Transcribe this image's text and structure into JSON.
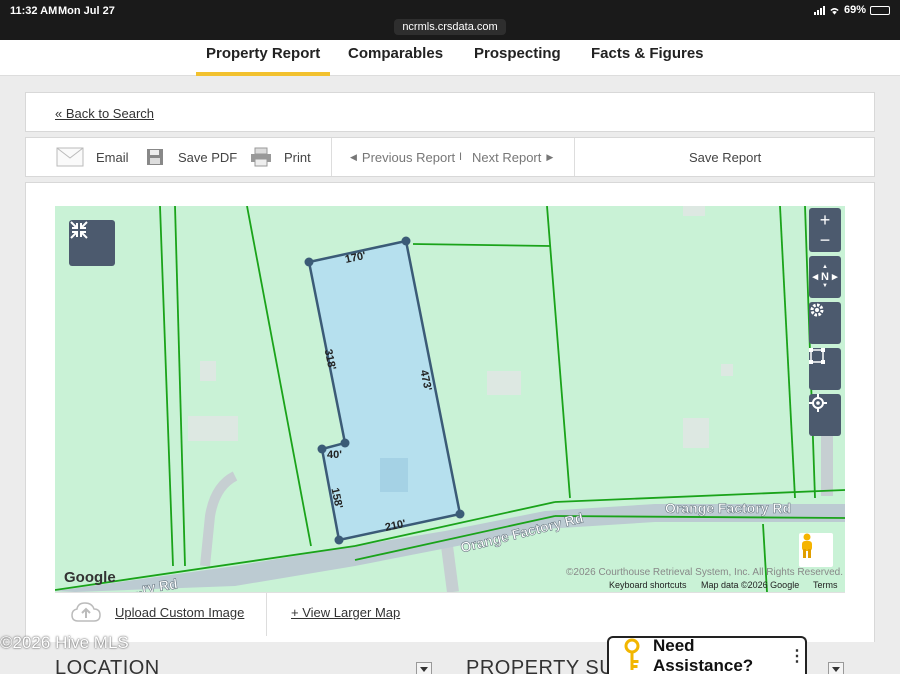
{
  "status": {
    "time": "11:32 AM",
    "date": "Mon Jul 27",
    "battery": "69%",
    "battery_level": 0.69,
    "url": "ncrmls.crsdata.com"
  },
  "nav": {
    "tabs": [
      {
        "label": "Property Report",
        "active": true
      },
      {
        "label": "Comparables",
        "active": false
      },
      {
        "label": "Prospecting",
        "active": false
      },
      {
        "label": "Facts & Figures",
        "active": false
      }
    ]
  },
  "back_link": "« Back to Search",
  "toolbar": {
    "email": "Email",
    "save_pdf": "Save PDF",
    "print": "Print",
    "previous": "Previous Report",
    "separator": "I",
    "next": "Next Report",
    "save_report": "Save Report"
  },
  "map": {
    "dimensions": {
      "top": "170'",
      "left_upper": "318'",
      "right": "473'",
      "notch": "40'",
      "left_lower": "158'",
      "bottom": "210'"
    },
    "road_label_1": "Orange Factory Rd",
    "road_label_2": "Orange Factory Rd",
    "road_label_3": "...ry Rd",
    "google": "Google",
    "copyright": "©2026 Courthouse Retrieval System, Inc. All Rights Reserved.",
    "keyboard": "Keyboard shortcuts",
    "mapdata": "Map data ©2026 Google",
    "terms": "Terms",
    "controls": {
      "zoom_in": "+",
      "zoom_out": "−",
      "north": "N"
    }
  },
  "upload": {
    "label": "Upload Custom Image",
    "larger_map": "+ View Larger Map"
  },
  "watermark": "©2026 Hive MLS",
  "sections": {
    "location": "LOCATION",
    "property": "PROPERTY SU"
  },
  "assist": {
    "label": "Need Assistance?"
  },
  "colors": {
    "accent": "#f2c12e",
    "map_bg": "#c9f2d6",
    "parcel_fill": "#b6e0ee",
    "parcel_line": "#3b5b77",
    "lot_lines": "#1aa31a",
    "control_bg": "#4c5a6e"
  }
}
